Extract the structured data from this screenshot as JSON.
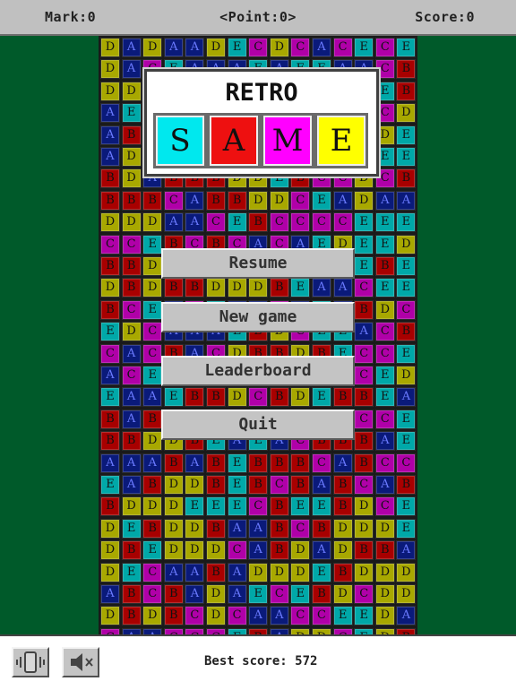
{
  "header": {
    "mark": "Mark:0",
    "point": "<Point:0>",
    "score": "Score:0"
  },
  "colors": {
    "A": "#0a1a7a",
    "B": "#a80000",
    "C": "#b000a8",
    "D": "#a8a800",
    "E": "#00a8a8",
    "background": "#005a2a"
  },
  "board": {
    "rows": [
      "DADAADECDCACECE",
      "DACEAAAEAEEAACB",
      "DDAEEAEEDEAAEEB",
      "AEACBDCBDEBAACD",
      "ABBDCABAABAEEDE",
      "ADAAEEEBBDEAAEE",
      "BDABBBDDEBCCDCB",
      "BBBCABBDDCEADAA",
      "DDDAACEBCCCCEEE",
      "CCEBCBCACAEDEED",
      "BBDAEAAEACCAEBE",
      "DBDBBDDDBEAACEE",
      "BCEACEAACAEABDC",
      "EDCAAAEBDCEEACB",
      "CACBACDBBDBECCE",
      "ACEBDBBDBAAECED",
      "EAAEBBDCBDEBBEA",
      "BABCABDDBCBACCE",
      "BBDDBEAEACBBBAE",
      "AAABABEBBBCABCC",
      "EABDDBEBCBABCAB",
      "BDDDEEECBEEBDCE",
      "DEBDDBAABCBDDDE",
      "DBEDDDCABDADBBA",
      "DECAABADDDEBDDD",
      "ABCBADAECEBDCDD",
      "DBDBCDCAACCEEDA",
      "CAACCCEBADDCEDB"
    ]
  },
  "logo": {
    "title": "RETRO",
    "letters": [
      "S",
      "A",
      "M",
      "E"
    ],
    "tile_colors": [
      "#00e8ee",
      "#ee1010",
      "#ff00ff",
      "#ffff00"
    ]
  },
  "menu": {
    "resume": "Resume",
    "new_game": "New game",
    "leaderboard": "Leaderboard",
    "quit": "Quit"
  },
  "footer": {
    "best_score": "Best score: 572",
    "vibrate_icon": "vibrate-icon",
    "mute_icon": "speaker-muted-icon"
  }
}
